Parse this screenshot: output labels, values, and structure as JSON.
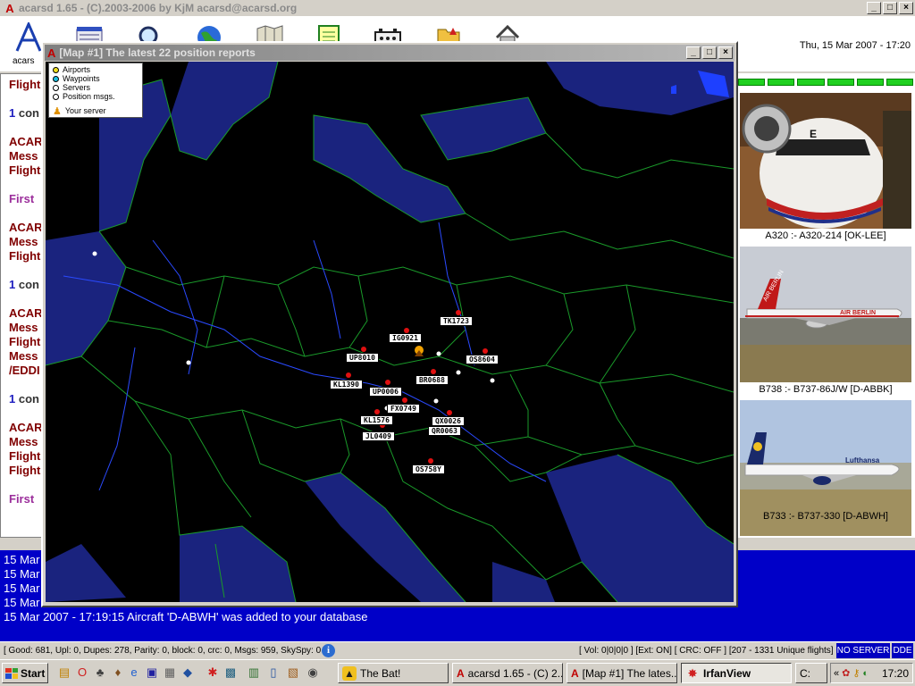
{
  "window": {
    "title": "acarsd 1.65 - (C).2003-2006 by KjM acarsd@acarsd.org",
    "min": "_",
    "max": "□",
    "close": "×"
  },
  "toolbar": {
    "datetime": "Thu, 15 Mar 2007 - 17:20",
    "first_label": "acars",
    "tools": [
      "acarsd-logo-icon",
      "database-icon",
      "search-icon",
      "globe-icon",
      "map-icon",
      "document-icon",
      "network-icon",
      "folder-icon",
      "house-icon"
    ]
  },
  "left_pane": {
    "lines": [
      {
        "text": "Flight",
        "style": "maroon"
      },
      {
        "text": "1 con",
        "style": "num"
      },
      {
        "text": "ACAR",
        "style": "maroon"
      },
      {
        "text": "Mess",
        "style": "maroon"
      },
      {
        "text": "Flight",
        "style": "maroon"
      },
      {
        "text": "First",
        "style": "purple"
      },
      {
        "text": "ACAR",
        "style": "maroon"
      },
      {
        "text": "Mess",
        "style": "maroon"
      },
      {
        "text": "Flight",
        "style": "maroon"
      },
      {
        "text": "1 con",
        "style": "num"
      },
      {
        "text": "ACAR",
        "style": "maroon"
      },
      {
        "text": "Mess",
        "style": "maroon"
      },
      {
        "text": "Flight",
        "style": "maroon"
      },
      {
        "text": "Mess",
        "style": "maroon"
      },
      {
        "text": "/EDDI",
        "style": "maroon"
      },
      {
        "text": "1 con",
        "style": "num"
      },
      {
        "text": "ACAR",
        "style": "maroon"
      },
      {
        "text": "Mess",
        "style": "maroon"
      },
      {
        "text": "Flight",
        "style": "maroon"
      },
      {
        "text": "Flight",
        "style": "maroon"
      },
      {
        "text": "First",
        "style": "purple"
      }
    ]
  },
  "right_pane": {
    "photos": [
      {
        "caption": "A320 :- A320-214 [OK-LEE]"
      },
      {
        "caption": "B738 :- B737-86J/W [D-ABBK]"
      },
      {
        "caption": "B733 :- B737-330 [D-ABWH]"
      }
    ]
  },
  "map_window": {
    "title": "[Map #1] The latest 22 position reports",
    "legend": [
      {
        "label": "Airports",
        "color": "#f0e020"
      },
      {
        "label": "Waypoints",
        "color": "#20c0e0"
      },
      {
        "label": "Servers",
        "color": "#ffffff"
      },
      {
        "label": "Position msgs.",
        "color": "#ffffff"
      }
    ],
    "legend_server": "Your server",
    "flights": [
      "TK1723",
      "IG0921",
      "UP8010",
      "OS8604",
      "BR0688",
      "KL1390",
      "UP0006",
      "FX0749",
      "KL1576",
      "QX0026",
      "QR0063",
      "JL0409",
      "OS758Y"
    ]
  },
  "log": {
    "lines": [
      "15 Mar",
      "15 Mar",
      "15 Mar",
      "15 Mar",
      "15 Mar 2007 - 17:19:15 Aircraft 'D-ABWH' was added to your database"
    ]
  },
  "status": {
    "left": "[ Good: 681, Upl: 0, Dupes: 278, Parity: 0, block: 0, crc: 0, Msgs: 959, SkySpy: 0 ]",
    "right": "[ Vol: 0|0|0|0 ]  [Ext: ON]  [ CRC: OFF ]  [207 - 1331 Unique flights]",
    "no_server": "NO SERVER",
    "dde": "DDE"
  },
  "taskbar": {
    "start": "Start",
    "tasks": [
      {
        "label": "The Bat!",
        "icon": "bat-icon"
      },
      {
        "label": "acarsd 1.65 - (C) 2...",
        "icon": "acarsd-icon"
      },
      {
        "label": "[Map #1] The lates...",
        "icon": "acarsd-icon"
      },
      {
        "label": "IrfanView",
        "icon": "irfanview-icon"
      },
      {
        "label": "C:",
        "icon": "drive-icon"
      }
    ],
    "clock": "17:20"
  }
}
